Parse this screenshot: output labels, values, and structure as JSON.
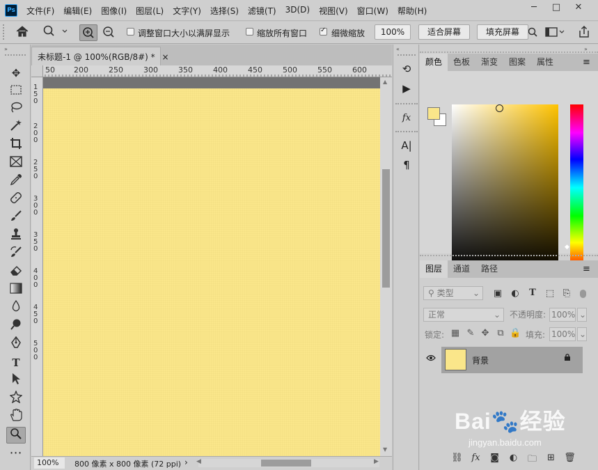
{
  "app": {
    "logo_text": "Ps",
    "menu": [
      "文件(F)",
      "编辑(E)",
      "图像(I)",
      "图层(L)",
      "文字(Y)",
      "选择(S)",
      "滤镜(T)",
      "3D(D)",
      "视图(V)",
      "窗口(W)",
      "帮助(H)"
    ],
    "window_controls": [
      "─",
      "□",
      "✕"
    ]
  },
  "options_bar": {
    "resize_windows_label": "调整窗口大小以满屏显示",
    "resize_windows_checked": false,
    "zoom_all_label": "缩放所有窗口",
    "zoom_all_checked": false,
    "scrubby_zoom_label": "细微缩放",
    "scrubby_zoom_checked": true,
    "zoom_value": "100%",
    "fit_screen_label": "适合屏幕",
    "fill_screen_label": "填充屏幕"
  },
  "document": {
    "tab_title": "未标题-1 @ 100%(RGB/8#) *",
    "tab_close": "×",
    "ruler_top": [
      "50",
      "200",
      "250",
      "300",
      "350",
      "400",
      "450",
      "500",
      "550",
      "600"
    ],
    "ruler_left": [
      "1\n5\n0",
      "2\n0\n0",
      "2\n5\n0",
      "3\n0\n0",
      "3\n5\n0",
      "4\n0\n0",
      "4\n5\n0",
      "5\n0\n0"
    ],
    "canvas_color": "#fae68a",
    "zoom_status": "100%",
    "info_status": "800 像素 x 800 像素 (72 ppi)",
    "info_arrow": "›"
  },
  "panels": {
    "color_tabs": [
      "颜色",
      "色板",
      "渐变",
      "图案",
      "属性"
    ],
    "color_active_tab": "颜色",
    "foreground_color": "#fae68a",
    "background_color": "#ffffff",
    "layers_tabs": [
      "图层",
      "通道",
      "路径"
    ],
    "layers_active_tab": "图层",
    "kind_filter": "类型",
    "blend_mode": "正常",
    "opacity_label": "不透明度:",
    "opacity_value": "100%",
    "lock_label": "锁定:",
    "fill_label": "填充:",
    "fill_value": "100%",
    "layers": [
      {
        "name": "背景",
        "locked": true,
        "visible": true
      }
    ]
  },
  "watermark": {
    "brand": "Bai🐾经验",
    "url": "jingyan.baidu.com"
  }
}
